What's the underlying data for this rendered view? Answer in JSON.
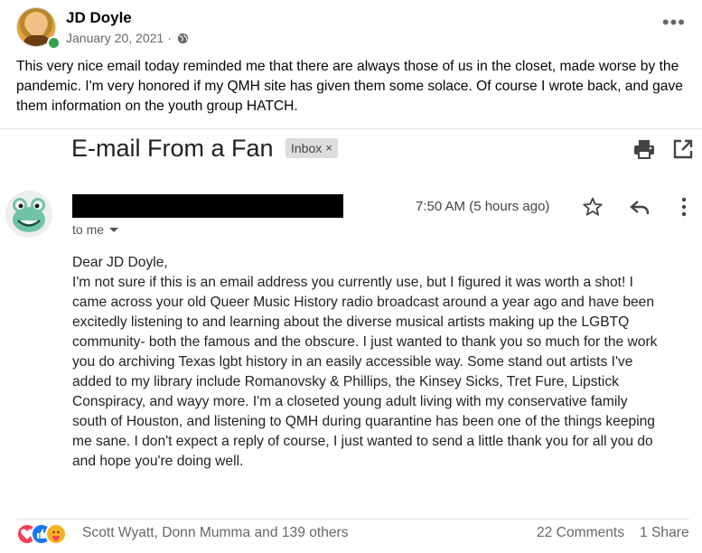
{
  "post": {
    "author": "JD Doyle",
    "date": "January 20, 2021",
    "separator": "·",
    "text": "This very nice email today reminded me that there are always those of us in the closet, made worse by the pandemic. I'm very honored if my QMH site has given them some solace. Of course I wrote back, and gave them information on the youth group HATCH.",
    "more_label": "•••"
  },
  "email": {
    "subject": "E-mail From a Fan",
    "chip_label": "Inbox",
    "chip_close": "×",
    "time": "7:50 AM (5 hours ago)",
    "to_label": "to me",
    "body_lines": [
      "Dear JD Doyle,",
      "I'm not sure if this is an email address you currently use, but I figured it was worth a shot! I",
      "came across your old Queer Music History radio broadcast around a year ago and have been",
      "excitedly listening to and learning about the diverse musical artists making up the LGBTQ",
      "community- both the famous and the obscure. I just wanted to thank you so much for the work",
      "you do archiving Texas lgbt history in an easily accessible way. Some stand out artists I've",
      "added to my library include Romanovsky & Phillips, the Kinsey Sicks, Tret Fure, Lipstick",
      "Conspiracy, and wayy more. I'm a closeted young adult living with my conservative family",
      "south of Houston, and listening to QMH during quarantine has been one of the things keeping",
      "me sane. I don't expect a reply of course, I just wanted to send a little thank you for all you do",
      "and hope you're doing well."
    ]
  },
  "reactions": {
    "icons": [
      "love-reaction-icon",
      "like-reaction-icon",
      "care-reaction-icon"
    ],
    "names": "Scott Wyatt, Donn Mumma and 139 others",
    "comments": "22 Comments",
    "shares": "1 Share"
  },
  "colors": {
    "facebook_blue": "#1877f2",
    "love": "#f33e58",
    "care": "#f7b125",
    "online": "#31a24c",
    "meta_gray": "#65676b"
  }
}
